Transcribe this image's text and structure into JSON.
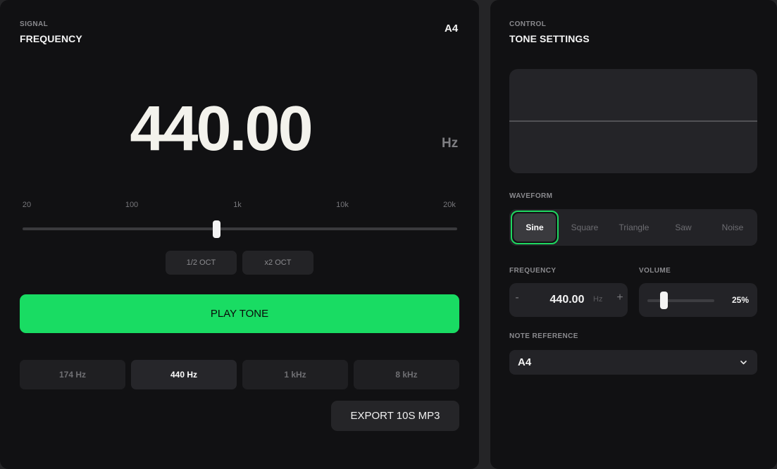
{
  "signal": {
    "eyebrow": "SIGNAL",
    "heading": "FREQUENCY",
    "note": "A4",
    "frequency_display": "440.00",
    "unit": "Hz",
    "scale_ticks": [
      "20",
      "100",
      "1k",
      "10k",
      "20k"
    ],
    "slider_value_hz": 440,
    "octave_buttons": [
      "1/2 OCT",
      "x2 OCT"
    ],
    "play_label": "PLAY TONE",
    "presets": [
      {
        "label": "174 Hz",
        "active": false
      },
      {
        "label": "440 Hz",
        "active": true
      },
      {
        "label": "1 kHz",
        "active": false
      },
      {
        "label": "8 kHz",
        "active": false
      }
    ],
    "export_label": "EXPORT 10S MP3"
  },
  "control": {
    "eyebrow": "CONTROL",
    "heading": "TONE SETTINGS",
    "waveform_label": "WAVEFORM",
    "waveforms": [
      "Sine",
      "Square",
      "Triangle",
      "Saw",
      "Noise"
    ],
    "selected_waveform": "Sine",
    "frequency_label": "FREQUENCY",
    "frequency_value": "440.00",
    "frequency_unit": "Hz",
    "minus": "-",
    "plus": "+",
    "volume_label": "VOLUME",
    "volume_value": "25%",
    "volume_fraction": 0.25,
    "note_reference_label": "NOTE REFERENCE",
    "note_reference_value": "A4"
  },
  "colors": {
    "accent": "#19dc63",
    "panel": "#111113",
    "surface": "#232327"
  }
}
